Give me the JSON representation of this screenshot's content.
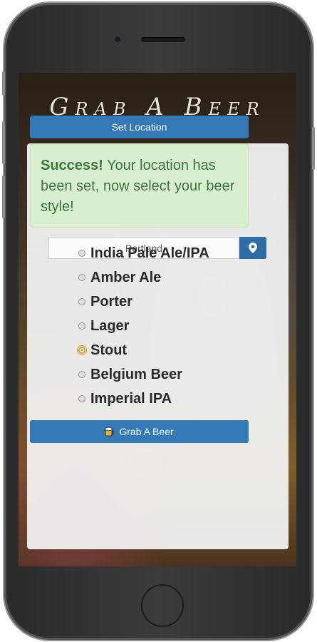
{
  "app": {
    "title": "Grab A Beer"
  },
  "location": {
    "value": "Portland",
    "set_label": "Set Location"
  },
  "alert": {
    "strong": "Success!",
    "message": " Your location has been set, now select your beer style!"
  },
  "styles": [
    {
      "label": "India Pale Ale/IPA",
      "selected": false
    },
    {
      "label": "Amber Ale",
      "selected": false
    },
    {
      "label": "Porter",
      "selected": false
    },
    {
      "label": "Lager",
      "selected": false
    },
    {
      "label": "Stout",
      "selected": true
    },
    {
      "label": "Belgium Beer",
      "selected": false
    },
    {
      "label": "Imperial IPA",
      "selected": false
    }
  ],
  "grab_button": {
    "label": "Grab A Beer",
    "icon": "beer-mug-icon"
  },
  "colors": {
    "primary": "#337ab7",
    "success_bg": "#d8efcf",
    "success_text": "#3c763d"
  }
}
